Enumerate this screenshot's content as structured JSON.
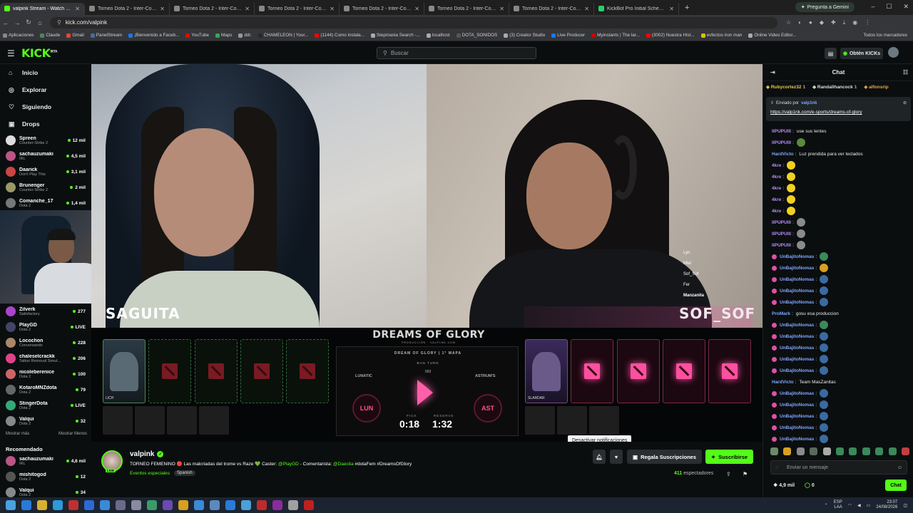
{
  "browser": {
    "tabs": [
      {
        "label": "valpink Stream - Watch Live",
        "active": true,
        "color": "#53fc18"
      },
      {
        "label": "Torneo Dota 2 - Inter-Comunid",
        "color": "#888"
      },
      {
        "label": "Torneo Dota 2 - Inter-Comunid",
        "color": "#888"
      },
      {
        "label": "Torneo Dota 2 - Inter-Comunid",
        "color": "#888"
      },
      {
        "label": "Torneo Dota 2 - Inter-Comunid",
        "color": "#888"
      },
      {
        "label": "Torneo Dota 2 - Inter-Comunid",
        "color": "#888"
      },
      {
        "label": "Torneo Dota 2 - Inter-Comunid",
        "color": "#888"
      },
      {
        "label": "KickBot Pro Initial Schema | SC",
        "color": "#2ecc71"
      }
    ],
    "gemini_label": "Pregunta a Gemini",
    "url": "kick.com/valpink",
    "bookmarks": [
      {
        "label": "Aplicaciones",
        "color": "#888"
      },
      {
        "label": "Claude",
        "color": "#4a8a5a"
      },
      {
        "label": "Gmail",
        "color": "#ea4335"
      },
      {
        "label": "PanelStream",
        "color": "#4a6aa0"
      },
      {
        "label": "¡Bienvenido a Faceb...",
        "color": "#1877f2"
      },
      {
        "label": "YouTube",
        "color": "#ff0000"
      },
      {
        "label": "Maps",
        "color": "#34a853"
      },
      {
        "label": "ddr.",
        "color": "#999"
      },
      {
        "label": "CHAMELEON | Your...",
        "color": "#2a2a2a"
      },
      {
        "label": "(1144) Como instala...",
        "color": "#ff0000"
      },
      {
        "label": "Stepmania Search -...",
        "color": "#aaa"
      },
      {
        "label": "localhost",
        "color": "#aaa"
      },
      {
        "label": "DOTA_SONIDOS",
        "color": "#555"
      },
      {
        "label": "(3) Creator Studio",
        "color": "#aaa"
      },
      {
        "label": "Live Producer",
        "color": "#1877f2"
      },
      {
        "label": "Myinstants | The lar...",
        "color": "#c00"
      },
      {
        "label": "(3002) Nuestra Hist...",
        "color": "#ff0000"
      },
      {
        "label": "evfectos iron man",
        "color": "#e0c000"
      },
      {
        "label": "Online Video Editor...",
        "color": "#aaa"
      }
    ],
    "all_bookmarks": "Todos los marcadores"
  },
  "kick": {
    "logo": "KICK",
    "logo_beta": "BETA",
    "search_placeholder": "Buscar",
    "get_kicks": "Obtén KICKs",
    "accent": "#53fc18"
  },
  "sidebar": {
    "nav": [
      {
        "label": "Inicio",
        "icon": "home-icon",
        "glyph": "⌂"
      },
      {
        "label": "Explorar",
        "icon": "compass-icon",
        "glyph": "◎"
      },
      {
        "label": "Siguiendo",
        "icon": "heart-icon",
        "glyph": "♡"
      },
      {
        "label": "Drops",
        "icon": "gift-icon",
        "glyph": "▣"
      }
    ],
    "following": [
      {
        "name": "Spreen",
        "category": "Counter-Strike 2",
        "count": "12 mil",
        "color": "#ddd"
      },
      {
        "name": "sachauzumaki",
        "category": "IRL",
        "count": "4,5 mil",
        "color": "#b58"
      },
      {
        "name": "Daarick",
        "category": "Don't Play This",
        "count": "3,1 mil",
        "color": "#c44"
      },
      {
        "name": "Brunenger",
        "category": "Counter-Strike 2",
        "count": "2 mil",
        "color": "#996"
      },
      {
        "name": "Comanche_17",
        "category": "Dota 2",
        "count": "1,4 mil",
        "color": "#777"
      },
      {
        "name": "Zilverk",
        "category": "Satisfactory",
        "count": "277",
        "color": "#a4c"
      },
      {
        "name": "PlayGD",
        "category": "Dota 2",
        "count": "LIVE",
        "color": "#446"
      },
      {
        "name": "Locochon",
        "category": "Conversando",
        "count": "228",
        "color": "#a86"
      },
      {
        "name": "chaleselcrackk",
        "category": "Tattoo Removal Simul...",
        "count": "206",
        "color": "#d48"
      },
      {
        "name": "nicoleberenice",
        "category": "Dota 2",
        "count": "100",
        "color": "#c66"
      },
      {
        "name": "KotaroMNZdota",
        "category": "Dota 2",
        "count": "79",
        "color": "#666"
      },
      {
        "name": "StingerDota",
        "category": "Dota 2",
        "count": "LIVE",
        "color": "#3a7"
      },
      {
        "name": "Valqui",
        "category": "Dota 2",
        "count": "32",
        "color": "#888"
      }
    ],
    "show_more": "Mostrar más",
    "show_less": "Mostrar Menos",
    "recommended_title": "Recomendado",
    "recommended": [
      {
        "name": "sachauzumaki",
        "category": "IRL",
        "count": "4,6 mil",
        "color": "#b58"
      },
      {
        "name": "mishitogod",
        "category": "Dota 2",
        "count": "12",
        "color": "#555"
      },
      {
        "name": "Valqui",
        "category": "Dota 2",
        "count": "34",
        "color": "#888"
      }
    ]
  },
  "video": {
    "left_name": "SAGUITA",
    "right_name": "SOF_SOF",
    "players": [
      "Lyn",
      "Miel",
      "Sof_Sof",
      "Fer",
      "Manzanita"
    ],
    "event_title": "DREAMS OF GLORY",
    "event_sub": "PRODUCCIÓN · VALP1NK.COM",
    "match_header": "DREAM OF GLORY | 1° MAPA",
    "ban_label": "BAN TURN",
    "ban_num": "003",
    "team_left": "LUNATIC",
    "team_left_short": "LUN",
    "team_right": "ASTRUM'S",
    "team_right_short": "AST",
    "pick_label": "PICK",
    "reserve_label": "RESERVE",
    "pick_time": "0:18",
    "reserve_time": "1:32",
    "left_hero": "LICH",
    "right_hero": "SLARDAR"
  },
  "tooltip": "Desactivar notificaciones",
  "stream": {
    "streamer": "valpink",
    "live_badge": "LIVE",
    "title_parts": [
      "TORNEO FEMENINO 🔴 Las malcriadas del trome vs Raze 💚 Caster: ",
      "@PlayGD",
      " - Comentarista: ",
      "@Daecita",
      " #dotaFem #DreamsOfGlory"
    ],
    "category": "Eventos especiales",
    "language": "Spanish",
    "subs_button": "Regala Suscripciones",
    "subscribe_button": "Suscribirse",
    "viewers_count": "411",
    "viewers_label": "espectadores"
  },
  "chat": {
    "title": "Chat",
    "gifters": [
      {
        "name": "Rubycortez32",
        "count": "1",
        "color": "#e8c84a"
      },
      {
        "name": "Randallhancock",
        "count": "1",
        "color": "#ddd"
      },
      {
        "name": "alfonsrip",
        "count": "",
        "color": "#e8a84a"
      }
    ],
    "pinned_by_label": "Enviado por",
    "pinned_by_user": "valp1nk",
    "pinned_link": "https://valp1nk.com/e-sports/dreams-of-glory",
    "messages": [
      {
        "user": "llPUPUlll",
        "text": "use sus lentes",
        "color": "#b98cff",
        "badge": false
      },
      {
        "user": "llPUPUlll",
        "text": "",
        "color": "#b98cff",
        "emote": "#5a8a3a",
        "badge": false
      },
      {
        "user": "HardVicto",
        "text": "Luz prendida para ver teclados",
        "color": "#7fa6ff",
        "badge": false
      },
      {
        "user": "4kre",
        "text": "",
        "color": "#b98cff",
        "emote": "#f0d020",
        "badge": false
      },
      {
        "user": "4kre",
        "text": "",
        "color": "#b98cff",
        "emote": "#f0d020",
        "badge": false
      },
      {
        "user": "4kre",
        "text": "",
        "color": "#b98cff",
        "emote": "#f0d020",
        "badge": false
      },
      {
        "user": "4kre",
        "text": "",
        "color": "#b98cff",
        "emote": "#f0d020",
        "badge": false
      },
      {
        "user": "4kre",
        "text": "",
        "color": "#b98cff",
        "emote": "#f0d020",
        "badge": false
      },
      {
        "user": "llPUPUlll",
        "text": "",
        "color": "#b98cff",
        "emote": "#8a8a8a",
        "badge": false
      },
      {
        "user": "llPUPUlll",
        "text": "",
        "color": "#b98cff",
        "emote": "#8a8a8a",
        "badge": false
      },
      {
        "user": "llPUPUlll",
        "text": "",
        "color": "#b98cff",
        "emote": "#8a8a8a",
        "badge": false
      },
      {
        "user": "UnBajitoNomas",
        "text": "",
        "color": "#7fa6ff",
        "emote": "#3a8a5a",
        "badge": true
      },
      {
        "user": "UnBajitoNomas",
        "text": "",
        "color": "#7fa6ff",
        "emote": "#d8a020",
        "badge": true
      },
      {
        "user": "UnBajitoNomas",
        "text": "",
        "color": "#7fa6ff",
        "emote": "#3a6aa0",
        "badge": true
      },
      {
        "user": "UnBajitoNomas",
        "text": "",
        "color": "#7fa6ff",
        "emote": "#3a6aa0",
        "badge": true
      },
      {
        "user": "UnBajitoNomas",
        "text": "",
        "color": "#7fa6ff",
        "emote": "#3a6aa0",
        "badge": true
      },
      {
        "user": "ProMark",
        "text": "gosu esa produccion",
        "color": "#7fa6ff",
        "badge": false
      },
      {
        "user": "UnBajitoNomas",
        "text": "",
        "color": "#7fa6ff",
        "emote": "#3a8a5a",
        "badge": true
      },
      {
        "user": "UnBajitoNomas",
        "text": "",
        "color": "#7fa6ff",
        "emote": "#3a6aa0",
        "badge": true
      },
      {
        "user": "UnBajitoNomas",
        "text": "",
        "color": "#7fa6ff",
        "emote": "#3a6aa0",
        "badge": true
      },
      {
        "user": "UnBajitoNomas",
        "text": "",
        "color": "#7fa6ff",
        "emote": "#3a6aa0",
        "badge": true
      },
      {
        "user": "UnBajitoNomas",
        "text": "",
        "color": "#7fa6ff",
        "emote": "#3a6aa0",
        "badge": true
      },
      {
        "user": "HardVicto",
        "text": "Team MasZanitas",
        "color": "#7fa6ff",
        "badge": false
      },
      {
        "user": "UnBajitoNomas",
        "text": "",
        "color": "#7fa6ff",
        "emote": "#3a6aa0",
        "badge": true
      },
      {
        "user": "UnBajitoNomas",
        "text": "",
        "color": "#7fa6ff",
        "emote": "#3a6aa0",
        "badge": true
      },
      {
        "user": "UnBajitoNomas",
        "text": "",
        "color": "#7fa6ff",
        "emote": "#3a6aa0",
        "badge": true
      },
      {
        "user": "UnBajitoNomas",
        "text": "",
        "color": "#7fa6ff",
        "emote": "#3a6aa0",
        "badge": true
      },
      {
        "user": "UnBajitoNomas",
        "text": "",
        "color": "#7fa6ff",
        "emote": "#3a6aa0",
        "badge": true
      }
    ],
    "emoji_colors": [
      "#6a8a6a",
      "#d8a020",
      "#8a8a8a",
      "#5a6a5a",
      "#aaaaaa",
      "#3a8a5a",
      "#3a8a5a",
      "#3a8a5a",
      "#3a8a5a",
      "#3a8a5a",
      "#c04040"
    ],
    "input_placeholder": "Enviar un mensaje",
    "kicks_count": "4,9 mil",
    "points_count": "0",
    "send_button": "Chat"
  },
  "taskbar": {
    "icons": [
      "#2a7ad8",
      "#d8b030",
      "#2a9ad8",
      "#c03030",
      "#2a6ad8",
      "#3a8ad8",
      "#6a6a8a",
      "#8a8aa0",
      "#3a9a6a",
      "#6a4ab0",
      "#d8a020",
      "#3a8ad8",
      "#5a8ac0",
      "#2a7ad8",
      "#4aa0d8",
      "#c02a2a",
      "#8a2aa0",
      "#a0a0a0",
      "#c02020"
    ],
    "lang": "ESP",
    "lang2": "LAA",
    "time": "23:07",
    "date": "24/08/2026"
  }
}
